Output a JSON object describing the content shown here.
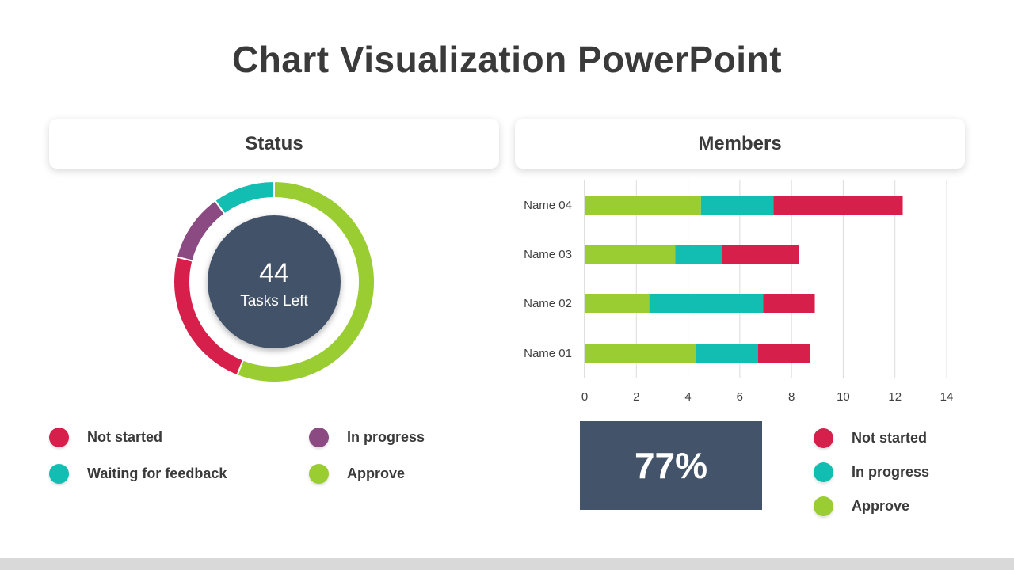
{
  "title": "Chart Visualization PowerPoint",
  "colors": {
    "not_started": "#D61F4A",
    "waiting": "#12BDB2",
    "in_progress": "#8C4A82",
    "approve": "#9ACD32",
    "center": "#435369"
  },
  "status": {
    "heading": "Status",
    "center_value": "44",
    "center_label": "Tasks Left",
    "legend": [
      {
        "label": "Not started",
        "color": "#D61F4A"
      },
      {
        "label": "In progress",
        "color": "#8C4A82"
      },
      {
        "label": "Waiting for feedback",
        "color": "#12BDB2"
      },
      {
        "label": "Approve",
        "color": "#9ACD32"
      }
    ]
  },
  "members": {
    "heading": "Members",
    "kpi": "77%",
    "legend": [
      {
        "label": "Not started",
        "color": "#D61F4A"
      },
      {
        "label": "In progress",
        "color": "#12BDB2"
      },
      {
        "label": "Approve",
        "color": "#9ACD32"
      }
    ]
  },
  "chart_data": [
    {
      "type": "pie",
      "subtype": "donut",
      "title": "Status",
      "slices": [
        {
          "label": "Approve",
          "value": 56,
          "color": "#9ACD32"
        },
        {
          "label": "Not started",
          "value": 23,
          "color": "#D61F4A"
        },
        {
          "label": "In progress",
          "value": 11,
          "color": "#8C4A82"
        },
        {
          "label": "Waiting for feedback",
          "value": 10,
          "color": "#12BDB2"
        }
      ]
    },
    {
      "type": "bar",
      "orientation": "horizontal",
      "stacked": true,
      "title": "Members",
      "categories": [
        "Name 04",
        "Name 03",
        "Name 02",
        "Name 01"
      ],
      "series": [
        {
          "name": "Approve",
          "color": "#9ACD32",
          "values": [
            4.5,
            3.5,
            2.5,
            4.3
          ]
        },
        {
          "name": "In progress",
          "color": "#12BDB2",
          "values": [
            2.8,
            1.8,
            4.4,
            2.4
          ]
        },
        {
          "name": "Not started",
          "color": "#D61F4A",
          "values": [
            5.0,
            3.0,
            2.0,
            2.0
          ]
        }
      ],
      "xlim": [
        0,
        14
      ],
      "xticks": [
        0,
        2,
        4,
        6,
        8,
        10,
        12,
        14
      ],
      "grid": true
    }
  ]
}
